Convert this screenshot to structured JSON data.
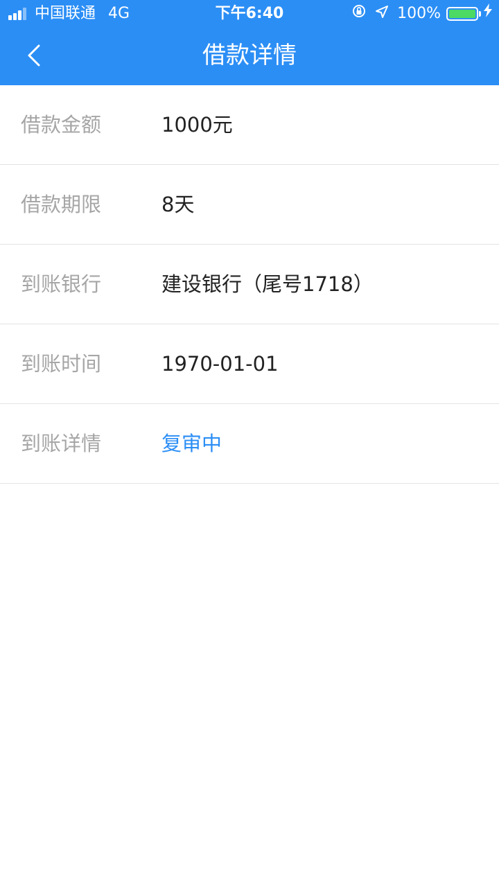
{
  "status_bar": {
    "carrier": "中国联通",
    "network": "4G",
    "time": "下午6:40",
    "battery_percent": "100%",
    "signal_bars": 3,
    "signal_total": 4,
    "battery_level": 1.0,
    "icons": [
      "orientation-lock-icon",
      "location-arrow-icon",
      "battery-icon",
      "charging-bolt-icon"
    ]
  },
  "nav": {
    "title": "借款详情",
    "back_icon": "back-chevron-icon"
  },
  "colors": {
    "header_bg": "#2b8ef5",
    "label": "#a6a6a6",
    "value": "#222222",
    "status_link": "#2b8ef5",
    "battery_fill": "#4cd964"
  },
  "details": [
    {
      "label": "借款金额",
      "value": "1000元"
    },
    {
      "label": "借款期限",
      "value": "8天"
    },
    {
      "label": "到账银行",
      "value": "建设银行（尾号1718）"
    },
    {
      "label": "到账时间",
      "value": "1970-01-01"
    },
    {
      "label": "到账详情",
      "value": "复审中"
    }
  ]
}
